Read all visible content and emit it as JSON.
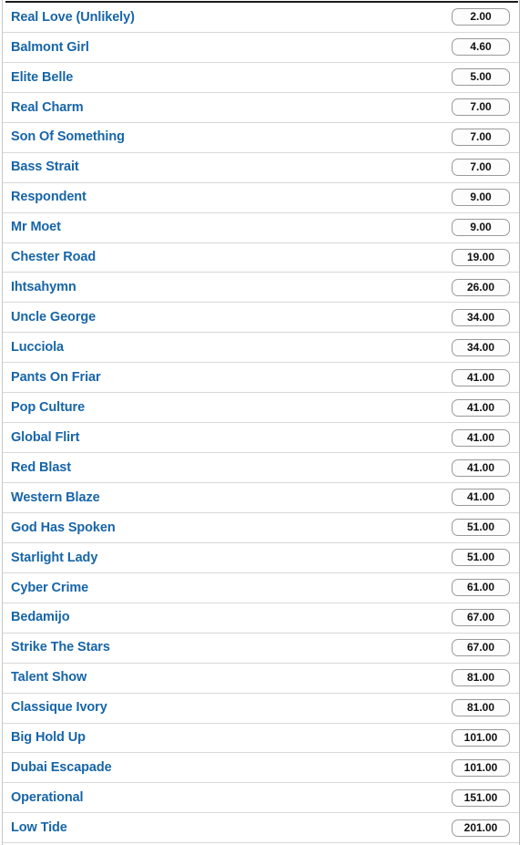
{
  "panel": {
    "name": "runner-odds-list",
    "accent_color": "#1765a8",
    "row_separator_color": "#d8d8d8",
    "button_border_color": "#9a9a9a",
    "button_background": "#fdfdfd",
    "top_rule_color": "#1b1b1b"
  },
  "runners": [
    {
      "name": "Real Love (Unlikely)",
      "odds": "2.00"
    },
    {
      "name": "Balmont Girl",
      "odds": "4.60"
    },
    {
      "name": "Elite Belle",
      "odds": "5.00"
    },
    {
      "name": "Real Charm",
      "odds": "7.00"
    },
    {
      "name": "Son Of Something",
      "odds": "7.00"
    },
    {
      "name": "Bass Strait",
      "odds": "7.00"
    },
    {
      "name": "Respondent",
      "odds": "9.00"
    },
    {
      "name": "Mr Moet",
      "odds": "9.00"
    },
    {
      "name": "Chester Road",
      "odds": "19.00"
    },
    {
      "name": "Ihtsahymn",
      "odds": "26.00"
    },
    {
      "name": "Uncle George",
      "odds": "34.00"
    },
    {
      "name": "Lucciola",
      "odds": "34.00"
    },
    {
      "name": "Pants On Friar",
      "odds": "41.00"
    },
    {
      "name": "Pop Culture",
      "odds": "41.00"
    },
    {
      "name": "Global Flirt",
      "odds": "41.00"
    },
    {
      "name": "Red Blast",
      "odds": "41.00"
    },
    {
      "name": "Western Blaze",
      "odds": "41.00"
    },
    {
      "name": "God Has Spoken",
      "odds": "51.00"
    },
    {
      "name": "Starlight Lady",
      "odds": "51.00"
    },
    {
      "name": "Cyber Crime",
      "odds": "61.00"
    },
    {
      "name": "Bedamijo",
      "odds": "67.00"
    },
    {
      "name": "Strike The Stars",
      "odds": "67.00"
    },
    {
      "name": "Talent Show",
      "odds": "81.00"
    },
    {
      "name": "Classique Ivory",
      "odds": "81.00"
    },
    {
      "name": "Big Hold Up",
      "odds": "101.00"
    },
    {
      "name": "Dubai Escapade",
      "odds": "101.00"
    },
    {
      "name": "Operational",
      "odds": "151.00"
    },
    {
      "name": "Low Tide",
      "odds": "201.00"
    }
  ]
}
